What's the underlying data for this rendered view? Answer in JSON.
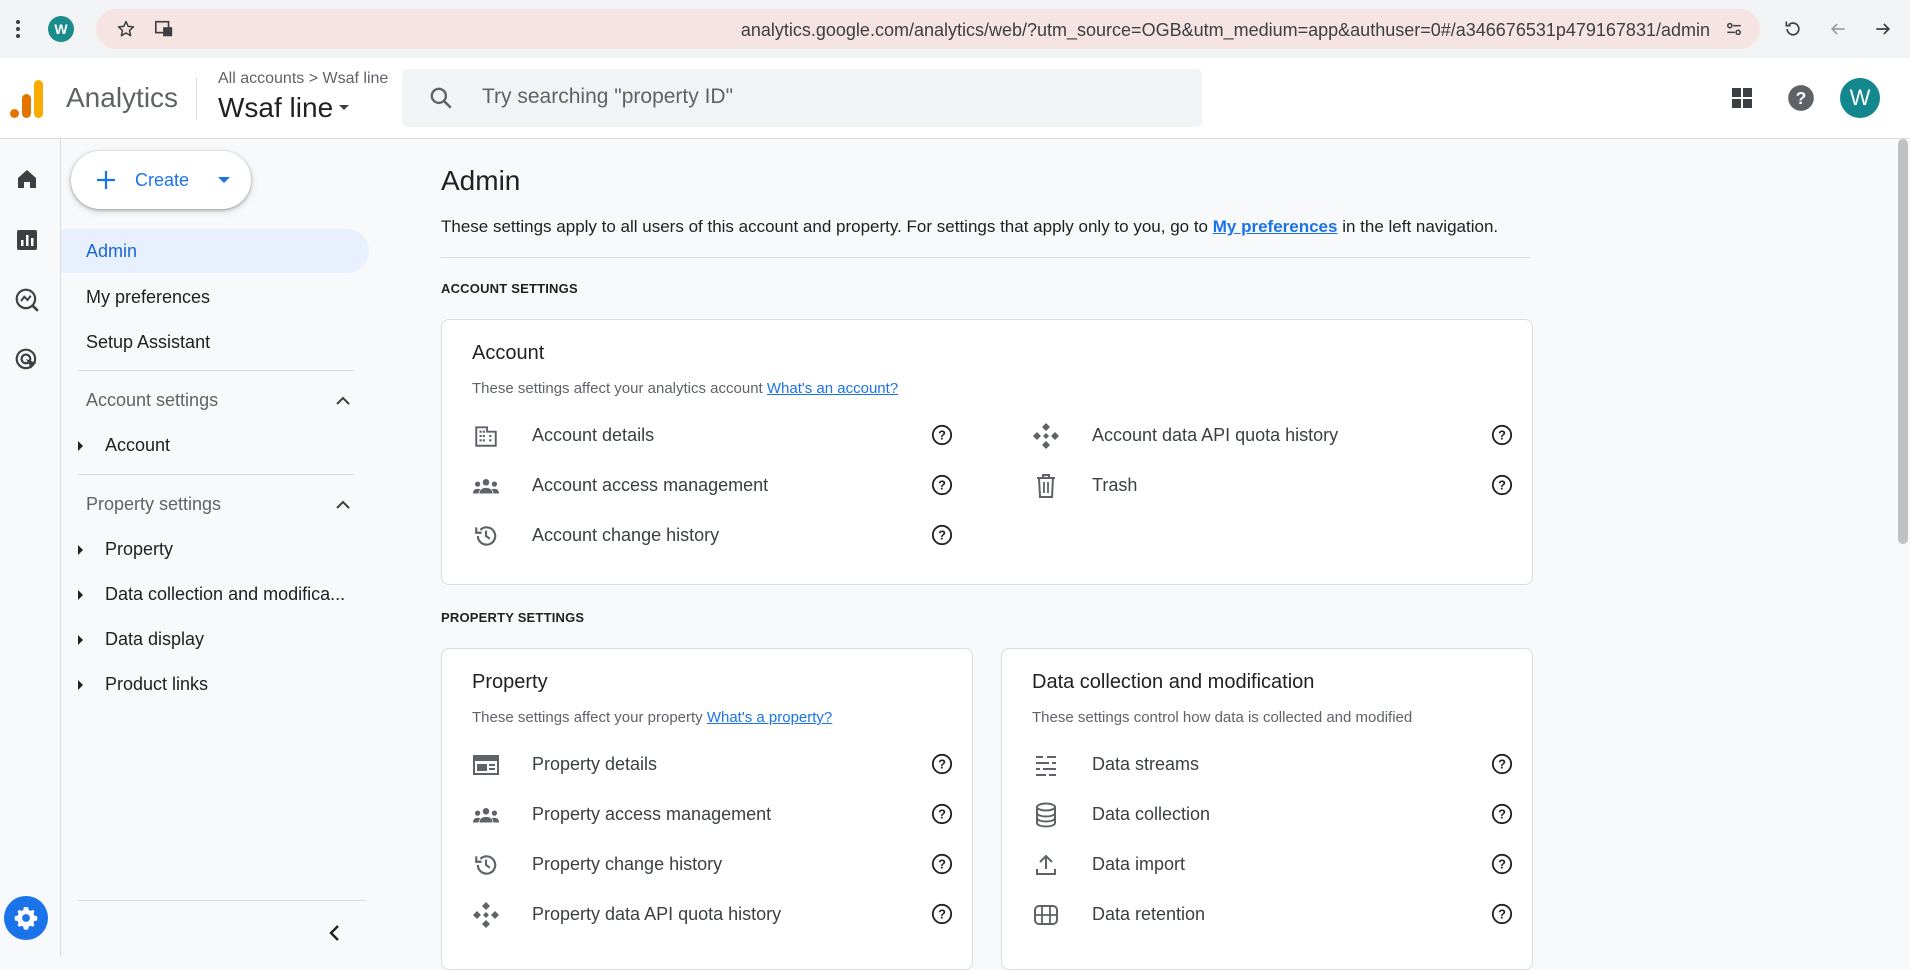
{
  "browser": {
    "favicon_letter": "W",
    "url": "analytics.google.com/analytics/web/?utm_source=OGB&utm_medium=app&authuser=0#/a346676531p479167831/admin"
  },
  "header": {
    "app_name": "Analytics",
    "breadcrumb_all": "All accounts",
    "breadcrumb_sep": ">",
    "breadcrumb_account": "Wsaf line",
    "property_name": "Wsaf line",
    "search_placeholder": "Try searching \"property ID\"",
    "avatar_letter": "W"
  },
  "nav": {
    "create_label": "Create",
    "admin": "Admin",
    "my_preferences": "My preferences",
    "setup_assistant": "Setup Assistant",
    "account_settings": "Account settings",
    "account": "Account",
    "property_settings": "Property settings",
    "property_items": [
      "Property",
      "Data collection and modifica...",
      "Data display",
      "Product links"
    ]
  },
  "main": {
    "title": "Admin",
    "desc_pre": "These settings apply to all users of this account and property. For settings that apply only to you, go to ",
    "desc_link": "My preferences",
    "desc_post": " in the left navigation.",
    "account_settings_label": "ACCOUNT SETTINGS",
    "property_settings_label": "PROPERTY SETTINGS",
    "account_card": {
      "title": "Account",
      "desc": "These settings affect your analytics account ",
      "link": "What's an account?",
      "items_left": [
        "Account details",
        "Account access management",
        "Account change history"
      ],
      "items_right": [
        "Account data API quota history",
        "Trash"
      ]
    },
    "property_card": {
      "title": "Property",
      "desc": "These settings affect your property ",
      "link": "What's a property?",
      "items": [
        "Property details",
        "Property access management",
        "Property change history",
        "Property data API quota history"
      ]
    },
    "data_card": {
      "title": "Data collection and modification",
      "desc": "These settings control how data is collected and modified",
      "items": [
        "Data streams",
        "Data collection",
        "Data import",
        "Data retention"
      ]
    }
  },
  "colors": {
    "accent": "#1a73e8",
    "selected_bg": "#e8f0fe",
    "avatar": "#12888e"
  }
}
